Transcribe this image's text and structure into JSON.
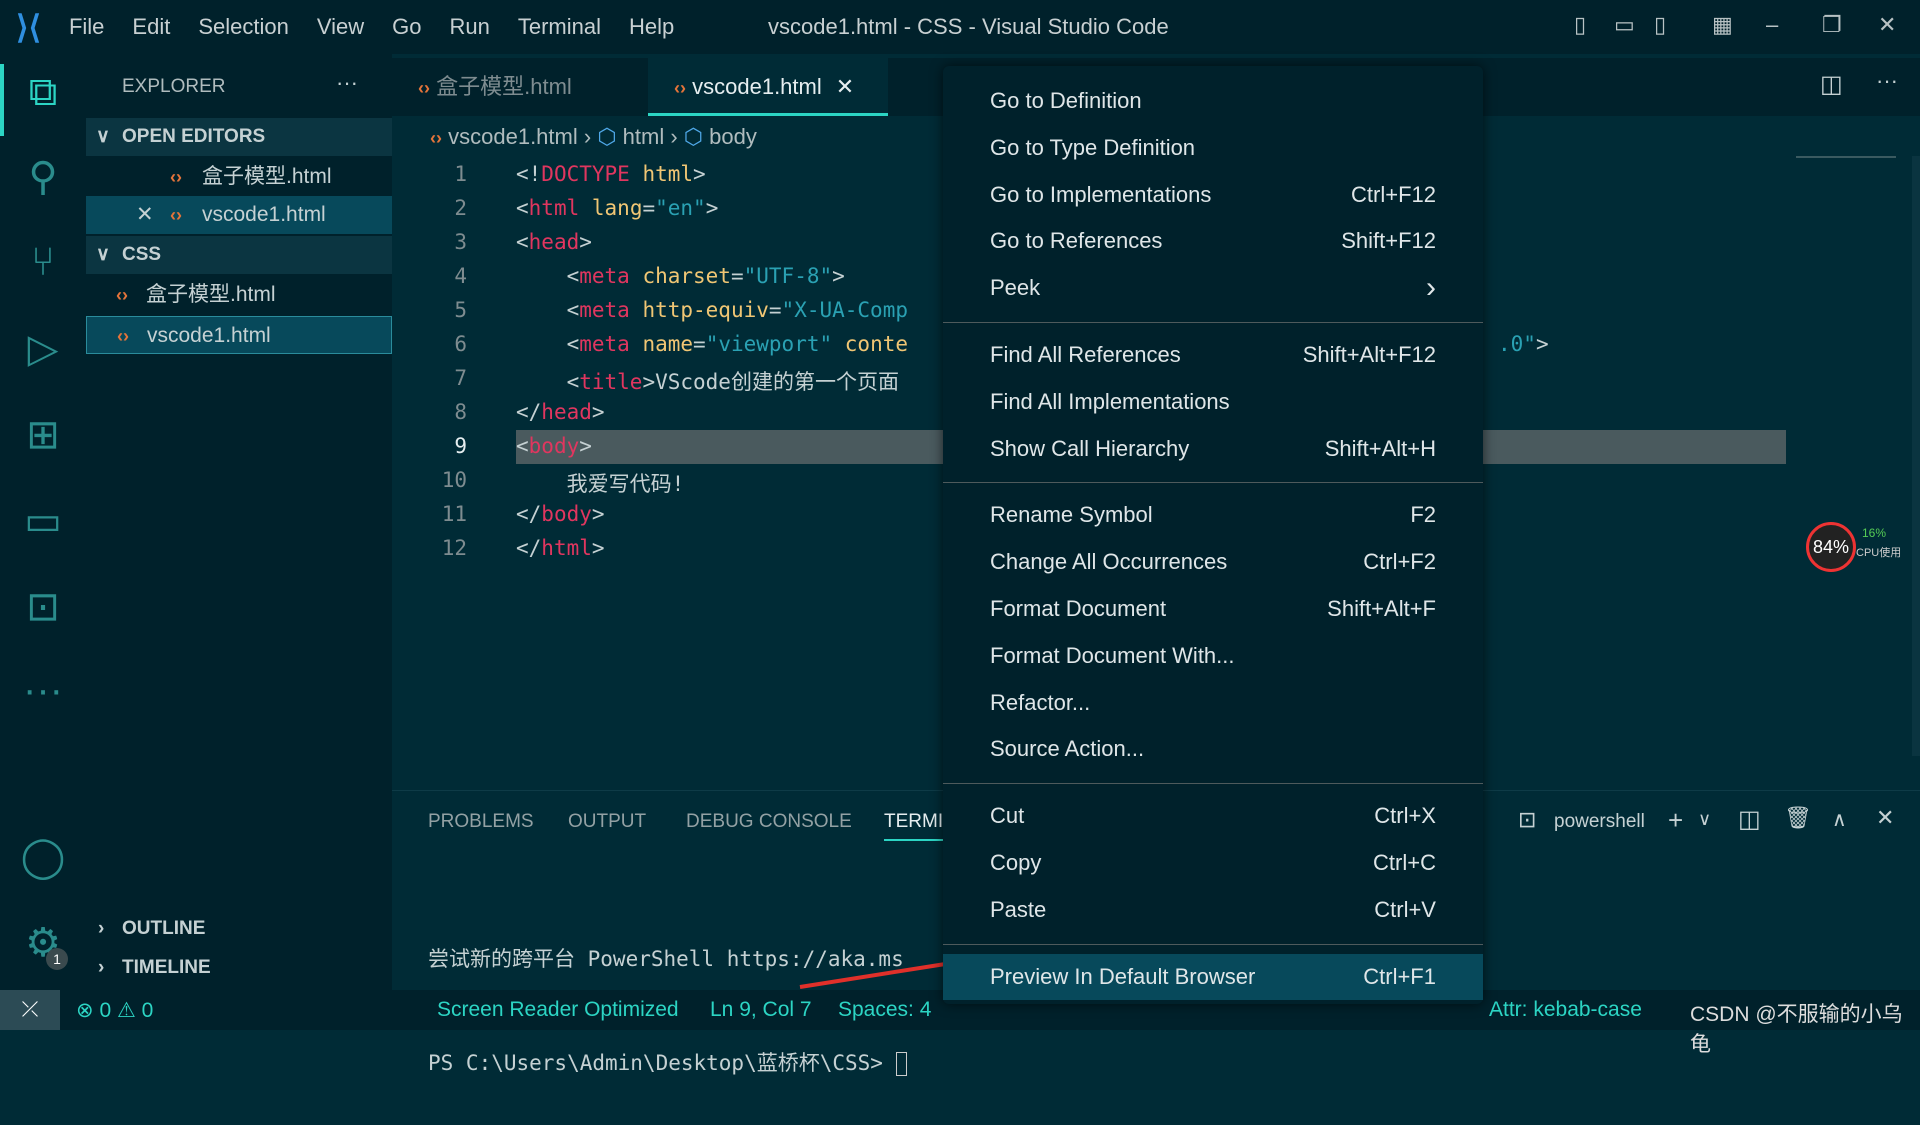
{
  "window": {
    "title": "vscode1.html - CSS - Visual Studio Code",
    "menus": [
      "File",
      "Edit",
      "Selection",
      "View",
      "Go",
      "Run",
      "Terminal",
      "Help"
    ]
  },
  "sidebar": {
    "title": "EXPLORER",
    "more": "···",
    "open_editors": "OPEN EDITORS",
    "open_files": [
      "盒子模型.html",
      "vscode1.html"
    ],
    "folder": "CSS",
    "files": [
      "盒子模型.html",
      "vscode1.html"
    ],
    "outline": "OUTLINE",
    "timeline": "TIMELINE"
  },
  "tabs": [
    {
      "label": "盒子模型.html"
    },
    {
      "label": "vscode1.html",
      "active": true
    }
  ],
  "breadcrumb": [
    "vscode1.html",
    "html",
    "body"
  ],
  "code": {
    "line_numbers": [
      "1",
      "2",
      "3",
      "4",
      "5",
      "6",
      "7",
      "8",
      "9",
      "10",
      "11",
      "12"
    ],
    "current_line": 9
  },
  "panel": {
    "tabs": [
      "PROBLEMS",
      "OUTPUT",
      "DEBUG CONSOLE",
      "TERMINAL"
    ],
    "active": "TERMINAL",
    "shell": "powershell",
    "lines": [
      "尝试新的跨平台 PowerShell https://aka.ms",
      "PS C:\\Users\\Admin\\Desktop\\蓝桥杯\\CSS> "
    ]
  },
  "context_menu": {
    "groups": [
      [
        {
          "label": "Go to Definition",
          "key": ""
        },
        {
          "label": "Go to Type Definition",
          "key": ""
        },
        {
          "label": "Go to Implementations",
          "key": "Ctrl+F12"
        },
        {
          "label": "Go to References",
          "key": "Shift+F12"
        },
        {
          "label": "Peek",
          "key": "›"
        }
      ],
      [
        {
          "label": "Find All References",
          "key": "Shift+Alt+F12"
        },
        {
          "label": "Find All Implementations",
          "key": ""
        },
        {
          "label": "Show Call Hierarchy",
          "key": "Shift+Alt+H"
        }
      ],
      [
        {
          "label": "Rename Symbol",
          "key": "F2"
        },
        {
          "label": "Change All Occurrences",
          "key": "Ctrl+F2"
        },
        {
          "label": "Format Document",
          "key": "Shift+Alt+F"
        },
        {
          "label": "Format Document With...",
          "key": ""
        },
        {
          "label": "Refactor...",
          "key": ""
        },
        {
          "label": "Source Action...",
          "key": ""
        }
      ],
      [
        {
          "label": "Cut",
          "key": "Ctrl+X"
        },
        {
          "label": "Copy",
          "key": "Ctrl+C"
        },
        {
          "label": "Paste",
          "key": "Ctrl+V"
        }
      ],
      [
        {
          "label": "Preview In Default Browser",
          "key": "Ctrl+F1"
        }
      ]
    ]
  },
  "cpu": {
    "percent": "84%",
    "usage": "16%",
    "usage_label": "CPU使用"
  },
  "status": {
    "errors": "0",
    "warnings": "0",
    "screen_reader": "Screen Reader Optimized",
    "position": "Ln 9, Col 7",
    "spaces": "Spaces: 4",
    "attr": "Attr: kebab-case",
    "watermark": "CSDN @不服输的小乌龟",
    "settings_badge": "1"
  },
  "colors": {
    "accent": "#2cd5c4",
    "background": "#002b36",
    "selection": "#07495b"
  }
}
